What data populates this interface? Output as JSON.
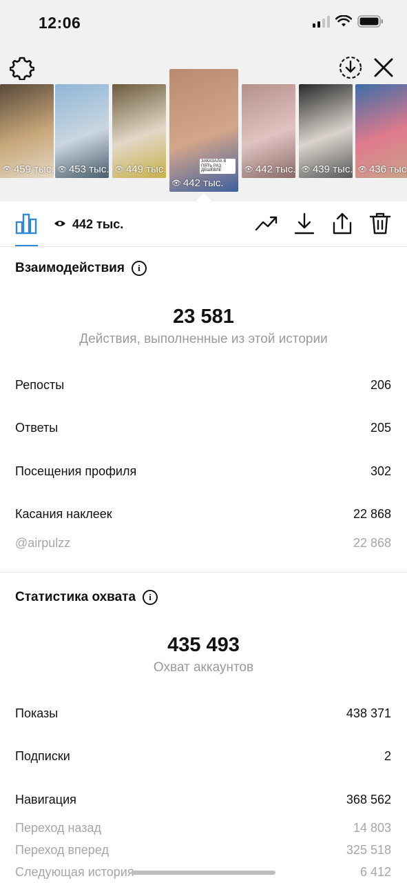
{
  "status_bar": {
    "time": "12:06"
  },
  "stories": [
    {
      "views": "459 тыс.",
      "colors": [
        "#5a4a3a",
        "#c8a77a",
        "#e3d8c4"
      ]
    },
    {
      "views": "453 тыс.",
      "colors": [
        "#8fb6d8",
        "#c9d6df",
        "#4a5f6e"
      ]
    },
    {
      "views": "449 тыс.",
      "colors": [
        "#6b5a3c",
        "#e2d7c6",
        "#c8b04a"
      ]
    },
    {
      "views": "442 тыс.",
      "caption": "ЗАКАЗАЛА В ПЯТЬ РАЗ ДЕШЕВЛЕ",
      "colors": [
        "#b88b6e",
        "#d3a58a",
        "#3d5fa0"
      ],
      "active": true
    },
    {
      "views": "442 тыс.",
      "colors": [
        "#b6908a",
        "#e0c3c0",
        "#8a6b68"
      ]
    },
    {
      "views": "439 тыс.",
      "colors": [
        "#2b2b2b",
        "#d9d3cc",
        "#5a5a5a"
      ]
    },
    {
      "views": "436 тыс.",
      "colors": [
        "#3e6ea8",
        "#e07a8c",
        "#c9a28a"
      ]
    }
  ],
  "toolbar": {
    "views": "442 тыс."
  },
  "interactions": {
    "title": "Взаимодействия",
    "total": "23 581",
    "total_label": "Действия, выполненные из этой истории",
    "rows": [
      {
        "label": "Репосты",
        "value": "206"
      },
      {
        "label": "Ответы",
        "value": "205"
      },
      {
        "label": "Посещения профиля",
        "value": "302"
      },
      {
        "label": "Касания наклеек",
        "value": "22 868"
      }
    ],
    "sub_rows": [
      {
        "label": "@airpulzz",
        "value": "22 868"
      }
    ]
  },
  "reach": {
    "title": "Статистика охвата",
    "total": "435 493",
    "total_label": "Охват аккаунтов",
    "rows": [
      {
        "label": "Показы",
        "value": "438 371"
      },
      {
        "label": "Подписки",
        "value": "2"
      },
      {
        "label": "Навигация",
        "value": "368 562"
      }
    ],
    "sub_rows": [
      {
        "label": "Переход назад",
        "value": "14 803"
      },
      {
        "label": "Переход вперед",
        "value": "325 518"
      },
      {
        "label": "Следующая история",
        "value": "6 412"
      }
    ]
  }
}
